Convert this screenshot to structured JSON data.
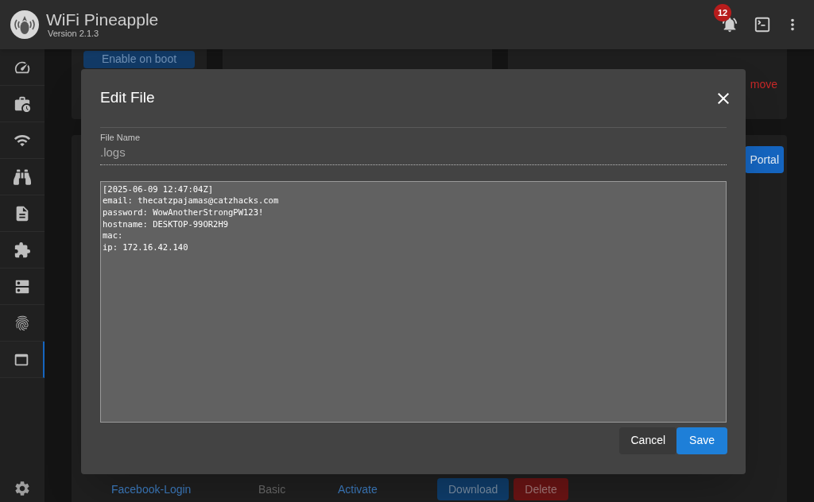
{
  "header": {
    "title": "WiFi Pineapple",
    "version": "Version 2.1.3",
    "notification_count": "12"
  },
  "sidebar": {
    "items": [
      {
        "selected": false
      },
      {
        "selected": false
      },
      {
        "selected": false
      },
      {
        "selected": false
      },
      {
        "selected": false
      },
      {
        "selected": false
      },
      {
        "selected": false
      },
      {
        "selected": false
      },
      {
        "selected": true
      }
    ]
  },
  "background": {
    "boot_button": "Enable on boot",
    "remove_link": "move",
    "portal_button": "Portal",
    "row": {
      "name": "Facebook-Login",
      "type": "Basic",
      "activate": "Activate",
      "download": "Download",
      "delete": "Delete"
    }
  },
  "dialog": {
    "title": "Edit File",
    "file_name_label": "File Name",
    "file_name": ".logs",
    "content": [
      "[2025-06-09 12:47:04Z]",
      "email: thecatzpajamas@catzhacks.com",
      "password: WowAnotherStrongPW123!",
      "hostname: DESKTOP-99OR2H9",
      "mac:",
      "ip: 172.16.42.140"
    ],
    "buttons": {
      "cancel": "Cancel",
      "save": "Save"
    }
  }
}
